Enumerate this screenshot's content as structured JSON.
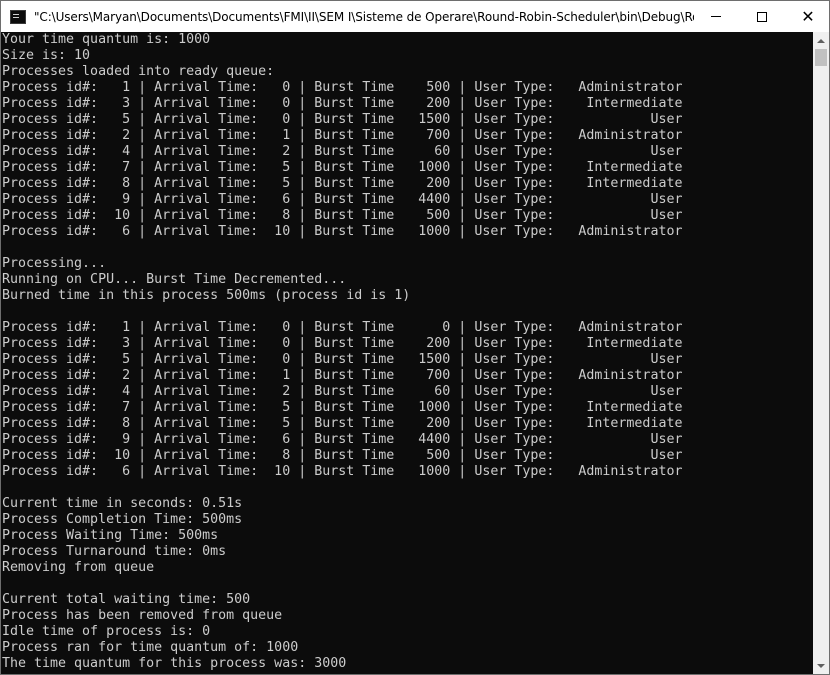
{
  "window": {
    "title": "\"C:\\Users\\Maryan\\Documents\\Documents\\FMI\\II\\SEM I\\Sisteme de Operare\\Round-Robin-Scheduler\\bin\\Debug\\Round-R...",
    "minimize_label": "",
    "maximize_label": "",
    "close_label": "✕"
  },
  "console": {
    "lines": [
      "Your time quantum is: 1000",
      "Size is: 10",
      "Processes loaded into ready queue:",
      "Process id#:   1 | Arrival Time:   0 | Burst Time    500 | User Type:   Administrator",
      "Process id#:   3 | Arrival Time:   0 | Burst Time    200 | User Type:    Intermediate",
      "Process id#:   5 | Arrival Time:   0 | Burst Time   1500 | User Type:            User",
      "Process id#:   2 | Arrival Time:   1 | Burst Time    700 | User Type:   Administrator",
      "Process id#:   4 | Arrival Time:   2 | Burst Time     60 | User Type:            User",
      "Process id#:   7 | Arrival Time:   5 | Burst Time   1000 | User Type:    Intermediate",
      "Process id#:   8 | Arrival Time:   5 | Burst Time    200 | User Type:    Intermediate",
      "Process id#:   9 | Arrival Time:   6 | Burst Time   4400 | User Type:            User",
      "Process id#:  10 | Arrival Time:   8 | Burst Time    500 | User Type:            User",
      "Process id#:   6 | Arrival Time:  10 | Burst Time   1000 | User Type:   Administrator",
      "",
      "Processing...",
      "Running on CPU... Burst Time Decremented...",
      "Burned time in this process 500ms (process id is 1)",
      "",
      "Process id#:   1 | Arrival Time:   0 | Burst Time      0 | User Type:   Administrator",
      "Process id#:   3 | Arrival Time:   0 | Burst Time    200 | User Type:    Intermediate",
      "Process id#:   5 | Arrival Time:   0 | Burst Time   1500 | User Type:            User",
      "Process id#:   2 | Arrival Time:   1 | Burst Time    700 | User Type:   Administrator",
      "Process id#:   4 | Arrival Time:   2 | Burst Time     60 | User Type:            User",
      "Process id#:   7 | Arrival Time:   5 | Burst Time   1000 | User Type:    Intermediate",
      "Process id#:   8 | Arrival Time:   5 | Burst Time    200 | User Type:    Intermediate",
      "Process id#:   9 | Arrival Time:   6 | Burst Time   4400 | User Type:            User",
      "Process id#:  10 | Arrival Time:   8 | Burst Time    500 | User Type:            User",
      "Process id#:   6 | Arrival Time:  10 | Burst Time   1000 | User Type:   Administrator",
      "",
      "Current time in seconds: 0.51s",
      "Process Completion Time: 500ms",
      "Process Waiting Time: 500ms",
      "Process Turnaround time: 0ms",
      "Removing from queue",
      "",
      "Current total waiting time: 500",
      "Process has been removed from queue",
      "Idle time of process is: 0",
      "Process ran for time quantum of: 1000",
      "The time quantum for this process was: 3000"
    ]
  },
  "colors": {
    "console_background": "#0c0c0c",
    "console_text": "#cccccc",
    "titlebar_background": "#ffffff"
  },
  "icons": {
    "app": "console-app-icon",
    "minimize": "minimize-icon",
    "maximize": "maximize-icon",
    "close": "close-icon",
    "scroll_up": "arrow-up-icon",
    "scroll_down": "arrow-down-icon"
  }
}
